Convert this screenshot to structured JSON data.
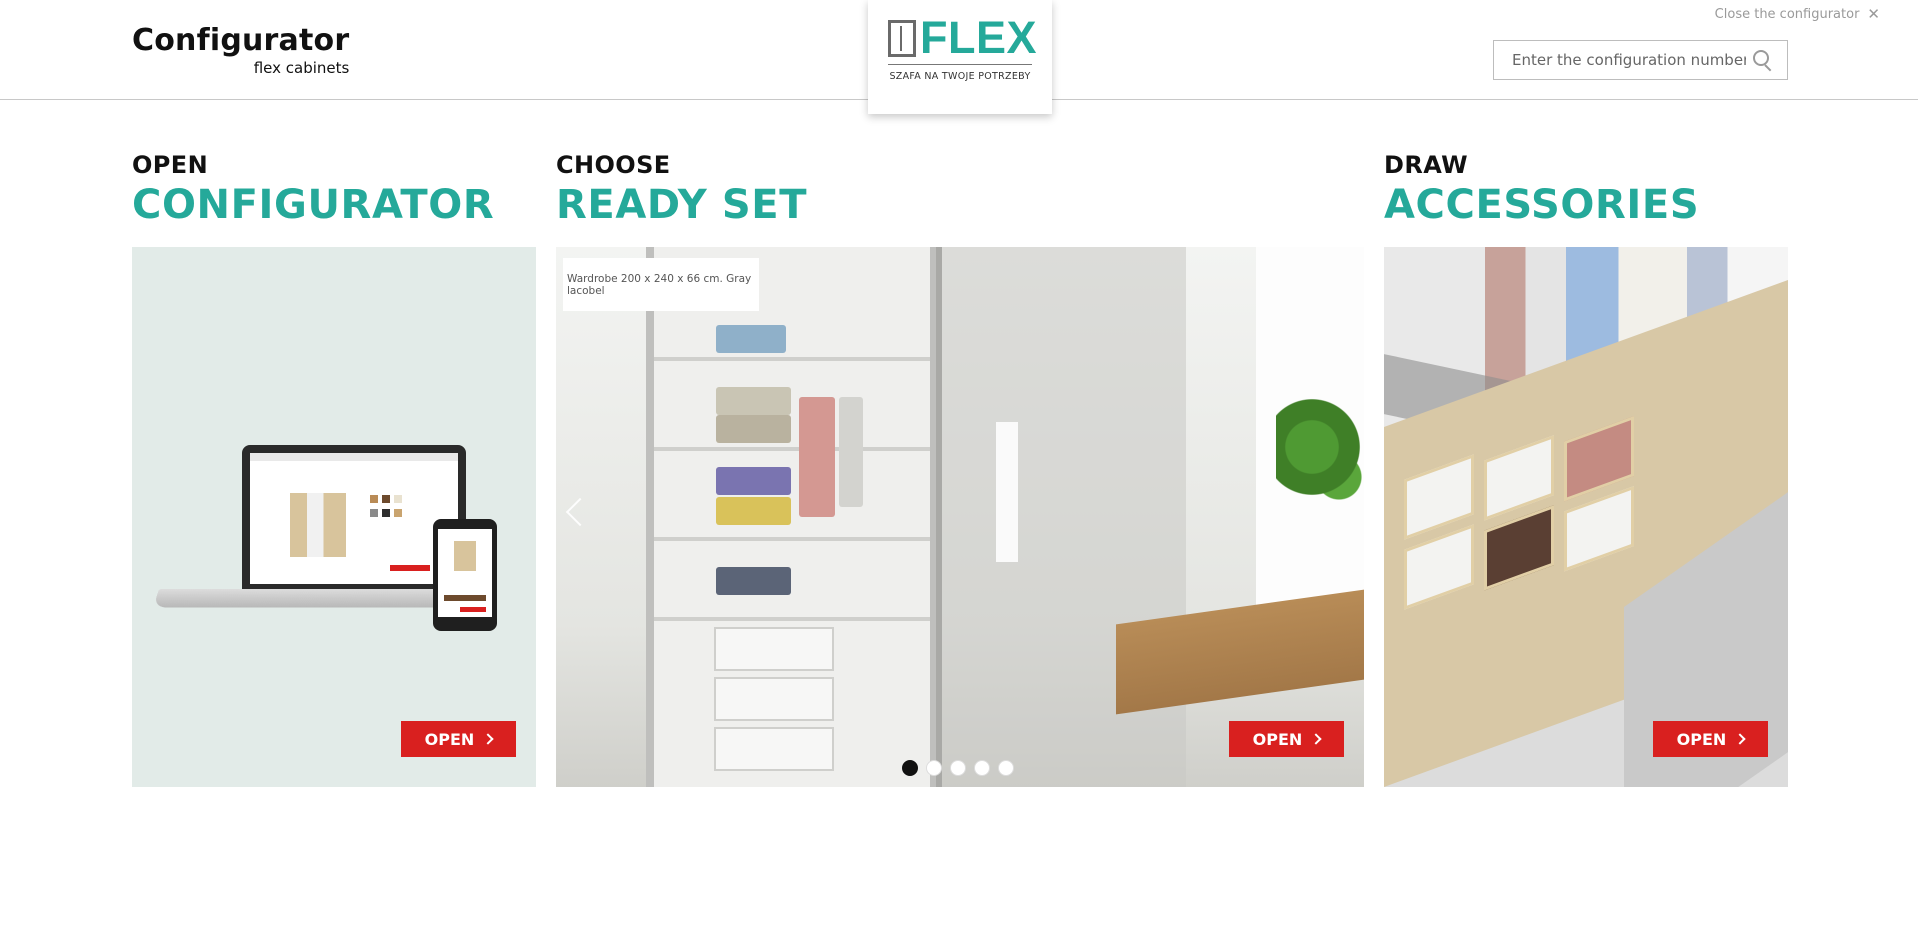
{
  "header": {
    "brand_title": "Configurator",
    "brand_subtitle": "flex cabinets",
    "logo_word": "FLEX",
    "logo_tagline": "SZAFA NA TWOJE POTRZEBY",
    "close_label": "Close the configurator",
    "close_icon": "close-icon",
    "search_placeholder": "Enter the configuration number",
    "search_icon": "search-icon"
  },
  "columns": [
    {
      "pre": "OPEN",
      "main": "CONFIGURATOR",
      "button": "OPEN"
    },
    {
      "pre": "CHOOSE",
      "main": "READY SET",
      "button": "OPEN",
      "caption": "Wardrobe 200 x 240 x 66 cm. Gray lacobel",
      "slides": 5,
      "active_slide": 1
    },
    {
      "pre": "DRAW",
      "main": "ACCESSORIES",
      "button": "OPEN"
    }
  ],
  "colors": {
    "accent": "#25a99a",
    "button": "#d9201f",
    "config_panel_bg": "#e2ebe8"
  }
}
